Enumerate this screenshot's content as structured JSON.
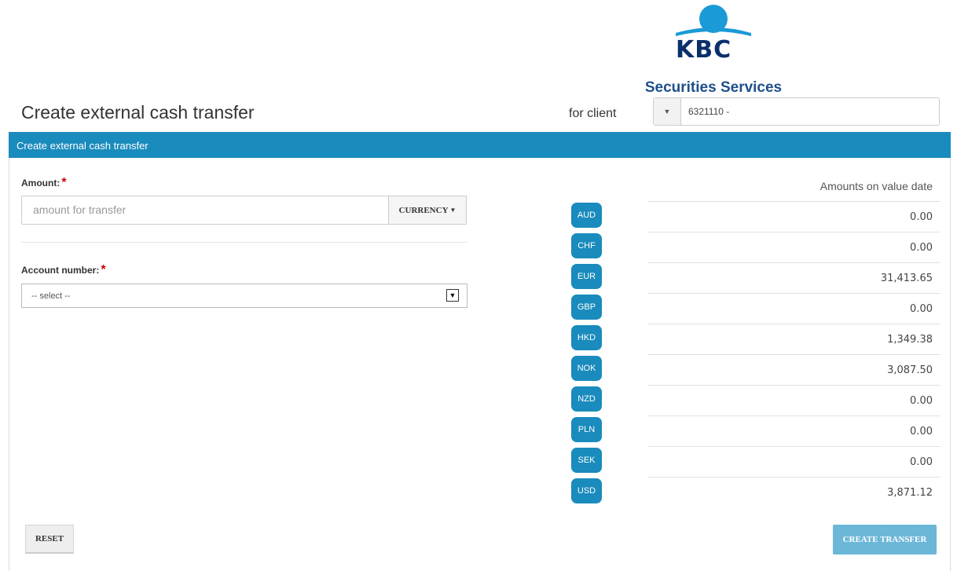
{
  "logo": {
    "brand": "KBC",
    "subtitle": "Securities Services"
  },
  "page_title": "Create external cash transfer",
  "for_client_label": "for client",
  "client_selector": {
    "value": "6321110 -"
  },
  "panel": {
    "title": "Create external cash transfer"
  },
  "form": {
    "amount_label": "Amount:",
    "amount_placeholder": "amount for transfer",
    "currency_button": "CURRENCY",
    "account_label": "Account number:",
    "account_select_value": "-- select --",
    "required_mark": "*"
  },
  "balances": {
    "header": "Amounts on value date",
    "rows": [
      {
        "currency": "AUD",
        "amount": "0.00"
      },
      {
        "currency": "CHF",
        "amount": "0.00"
      },
      {
        "currency": "EUR",
        "amount": "31,413.65"
      },
      {
        "currency": "GBP",
        "amount": "0.00"
      },
      {
        "currency": "HKD",
        "amount": "1,349.38"
      },
      {
        "currency": "NOK",
        "amount": "3,087.50"
      },
      {
        "currency": "NZD",
        "amount": "0.00"
      },
      {
        "currency": "PLN",
        "amount": "0.00"
      },
      {
        "currency": "SEK",
        "amount": "0.00"
      },
      {
        "currency": "USD",
        "amount": "3,871.12"
      }
    ]
  },
  "buttons": {
    "reset": "RESET",
    "create": "CREATE TRANSFER"
  },
  "colors": {
    "brand_blue": "#1a8bbd",
    "logo_navy": "#0a2f6b",
    "required_red": "#cc0000"
  }
}
